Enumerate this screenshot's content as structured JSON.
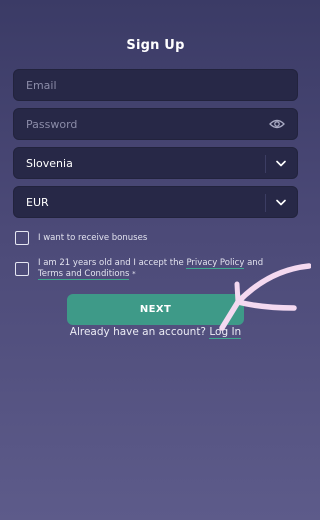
{
  "form": {
    "title": "Sign Up",
    "email_placeholder": "Email",
    "password_placeholder": "Password",
    "country": {
      "value": "Slovenia"
    },
    "currency": {
      "value": "EUR"
    }
  },
  "checkboxes": {
    "bonuses": {
      "label": "I want to receive bonuses",
      "checked": false
    },
    "terms": {
      "prefix": "I am 21 years old and I accept the ",
      "privacy_link": "Privacy Policy",
      "and_text": " and",
      "terms_link": "Terms and Conditions",
      "required_mark": "*",
      "checked": false
    }
  },
  "actions": {
    "next_label": "NEXT",
    "account_prompt": "Already have an account?",
    "login_link": "Log In"
  },
  "colors": {
    "accent": "#3e9a88",
    "field_bg": "#272847",
    "arrow": "#f4d9f0"
  },
  "icons": [
    "eye-icon",
    "chevron-down-icon",
    "hand-drawn-arrow"
  ]
}
